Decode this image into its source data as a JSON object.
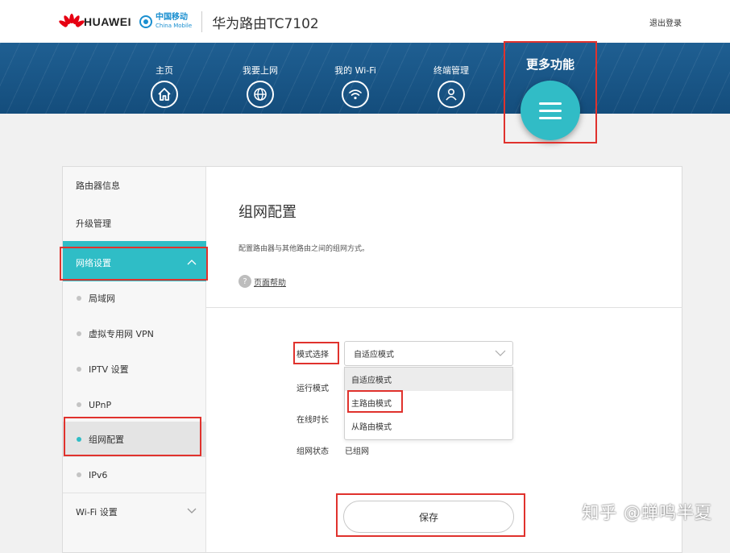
{
  "header": {
    "brand": "HUAWEI",
    "partner_cn": "中国移动",
    "partner_en": "China Mobile",
    "product": "华为路由TC7102",
    "logout": "退出登录"
  },
  "nav": {
    "items": [
      {
        "label": "主页",
        "icon": "home-icon"
      },
      {
        "label": "我要上网",
        "icon": "globe-icon"
      },
      {
        "label": "我的 Wi-Fi",
        "icon": "wifi-icon"
      },
      {
        "label": "终端管理",
        "icon": "user-icon"
      }
    ],
    "more": {
      "label": "更多功能",
      "icon": "menu-icon"
    }
  },
  "sidebar": {
    "items": [
      {
        "label": "路由器信息"
      },
      {
        "label": "升级管理"
      },
      {
        "label": "网络设置",
        "expanded": true
      },
      {
        "label": "Wi-Fi 设置"
      }
    ],
    "subitems": [
      {
        "label": "局域网"
      },
      {
        "label": "虚拟专用网 VPN"
      },
      {
        "label": "IPTV 设置"
      },
      {
        "label": "UPnP"
      },
      {
        "label": "组网配置",
        "selected": true
      },
      {
        "label": "IPv6"
      }
    ]
  },
  "content": {
    "title": "组网配置",
    "description": "配置路由器与其他路由之间的组网方式。",
    "help": "页面帮助",
    "fields": {
      "mode_label": "模式选择",
      "mode_value": "自适应模式",
      "run_mode_label": "运行模式",
      "online_label": "在线时长",
      "status_label": "组网状态",
      "status_value": "已组网"
    },
    "dropdown_options": [
      "自适应模式",
      "主路由模式",
      "从路由模式"
    ],
    "save": "保存"
  },
  "watermark": "知乎 @蝉鸣半夏",
  "colors": {
    "accent": "#2fbdc6",
    "nav": "#1a5a8e",
    "highlight": "#e0322d"
  }
}
